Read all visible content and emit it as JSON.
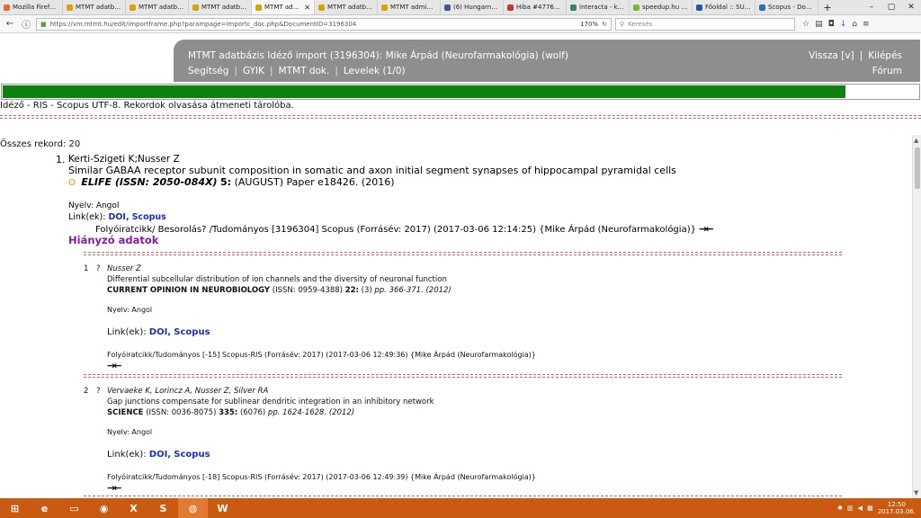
{
  "browser": {
    "tabs": [
      {
        "label": "Mozilla Firefox...",
        "color": "#e8662b",
        "active": false
      },
      {
        "label": "MTMT adatbázi...",
        "color": "#d9a400",
        "active": false
      },
      {
        "label": "MTMT adatbázi...",
        "color": "#d9a400",
        "active": false
      },
      {
        "label": "MTMT adatbázi...",
        "color": "#d9a400",
        "active": false
      },
      {
        "label": "MTMT ada...",
        "color": "#d9a400",
        "active": true
      },
      {
        "label": "MTMT adatbázi...",
        "color": "#d9a400",
        "active": false
      },
      {
        "label": "MTMT admin f...",
        "color": "#d9a400",
        "active": false
      },
      {
        "label": "(6) Hungarnet ...",
        "color": "#3b5998",
        "active": false
      },
      {
        "label": "Hiba #4776: Ért...",
        "color": "#c0392b",
        "active": false
      },
      {
        "label": "Interacta - külf...",
        "color": "#2e8b57",
        "active": false
      },
      {
        "label": "speedup.hu - K...",
        "color": "#7cb342",
        "active": false
      },
      {
        "label": "Főoldal :: SUWE...",
        "color": "#1e5aa8",
        "active": false
      },
      {
        "label": "Scopus - Docu...",
        "color": "#2a6ebb",
        "active": false
      }
    ],
    "tab_close_glyph": "✕",
    "new_tab_glyph": "+",
    "url": "https://vm.mtmt.hu/edit/importframe.php?parampage=importc_doc.php&DocumentID=3196304",
    "zoom": "170%",
    "search_placeholder": "Keresés"
  },
  "app": {
    "header_title": "MTMT adatbázis Idéző import (3196304): Mike Árpád (Neurofarmakológia) (wolf)",
    "menu": [
      "Segítség",
      "GYIK",
      "MTMT dok.",
      "Levelek (1/0)"
    ],
    "menu_separator": "|",
    "right_links": [
      "Vissza [v]",
      "Kilépés"
    ],
    "forum_link": "Fórum"
  },
  "progress": {
    "fraction": 0.92
  },
  "status_line": "Idéző - RIS - Scopus UTF-8. Rekordok olvasása átmeneti tárolóba.",
  "summary": {
    "total_records": "Összes rekord: 20"
  },
  "record": {
    "number": "1.",
    "authors": "Kerti-Szigeti K;Nusser Z",
    "title": "Similar GABAA receptor subunit composition in somatic and axon initial segment synapses of hippocampal pyramidal cells",
    "journal_icon": "ʘ",
    "journal": "ELIFE (ISSN: 2050-084X)",
    "volume": "5:",
    "issue_pages": "(AUGUST) Paper e18426. (2016)",
    "language": "Nyelv: Angol",
    "links_label": "Link(ek):",
    "link_doi": "DOI,",
    "link_scopus": "Scopus",
    "category": "Folyóiratcikk/ Besorolás? /Tudományos [3196304] Scopus (Forrásév: 2017) (2017-03-06 12:14:25) {Mike Árpád (Neurofarmakológia)}",
    "arrows": "→←",
    "missing_data": "Hiányzó adatok"
  },
  "citations": [
    {
      "num": "1",
      "q": "?",
      "authors": "Nusser Z",
      "title": "Differential subcellular distribution of ion channels and the diversity of neuronal function",
      "journal": "CURRENT OPINION IN NEUROBIOLOGY",
      "issn": "(ISSN: 0959-4388)",
      "volume": "22:",
      "issue": "(3)",
      "pages": "pp. 366-371. (2012)",
      "language": "Nyelv: Angol",
      "links_label": "Link(ek):",
      "link_doi": "DOI,",
      "link_scopus": "Scopus",
      "category": "Folyóiratcikk/Tudományos [-15] Scopus-RIS (Forrásév: 2017) (2017-03-06 12:49:36) {Mike Árpád (Neurofarmakológia)}",
      "arrows": "→←"
    },
    {
      "num": "2",
      "q": "?",
      "authors": "Vervaeke K, Lorincz A, Nusser Z, Silver RA",
      "title": "Gap junctions compensate for sublinear dendritic integration in an inhibitory network",
      "journal": "SCIENCE",
      "issn": "(ISSN: 0036-8075)",
      "volume": "335:",
      "issue": "(6076)",
      "pages": "pp. 1624-1628. (2012)",
      "language": "Nyelv: Angol",
      "links_label": "Link(ek):",
      "link_doi": "DOI,",
      "link_scopus": "Scopus",
      "category": "Folyóiratcikk/Tudományos [-18] Scopus-RIS (Forrásév: 2017) (2017-03-06 12:49:39) {Mike Árpád (Neurofarmakológia)}",
      "arrows": "→←"
    }
  ],
  "taskbar": {
    "items": [
      {
        "name": "start-icon",
        "glyph": "⊞"
      },
      {
        "name": "edge-icon",
        "glyph": "e"
      },
      {
        "name": "file-explorer-icon",
        "glyph": "▭"
      },
      {
        "name": "chrome-icon",
        "glyph": "◉"
      },
      {
        "name": "excel-icon",
        "glyph": "X"
      },
      {
        "name": "skype-icon",
        "glyph": "S"
      },
      {
        "name": "firefox-icon",
        "glyph": "◍"
      },
      {
        "name": "word-icon",
        "glyph": "W"
      }
    ],
    "time": "12:50",
    "date": "2017.03.06."
  },
  "colors": {
    "header_bg": "#8e8e8e",
    "progress_green": "#0d800d",
    "link_blue": "#1a2fc0",
    "missing_purple": "#8b1aa7",
    "taskbar_orange": "#c85a12"
  }
}
